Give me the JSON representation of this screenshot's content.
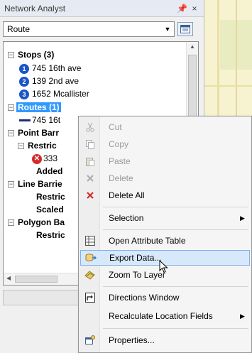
{
  "window": {
    "title": "Network Analyst",
    "pin_glyph": "ͱ",
    "close_glyph": "×"
  },
  "combo": {
    "value": "Route"
  },
  "tree": {
    "stops_header": "Stops (3)",
    "stops": [
      {
        "num": "1",
        "label": "745 16th ave"
      },
      {
        "num": "2",
        "label": "139 2nd ave"
      },
      {
        "num": "3",
        "label": "1652 Mcallister"
      }
    ],
    "routes_header": "Routes (1)",
    "route_item": "745 16t",
    "point_barriers": "Point Barr",
    "restrictions_1": "Restric",
    "barrier_item": "333",
    "added": "Added",
    "line_barriers": "Line Barrie",
    "restrictions_2": "Restric",
    "scaled": "Scaled",
    "polygon_barriers": "Polygon Ba",
    "restrictions_3": "Restric"
  },
  "menu": {
    "items": [
      {
        "label": "Cut",
        "icon": "scissors-icon"
      },
      {
        "label": "Copy",
        "icon": "copy-icon"
      },
      {
        "label": "Paste",
        "icon": "paste-icon"
      },
      {
        "label": "Delete",
        "icon": "delete-icon"
      },
      {
        "label": "Delete All",
        "icon": "delete-all-icon"
      },
      {
        "label": "Selection",
        "icon": ""
      },
      {
        "label": "Open Attribute Table",
        "icon": "table-icon"
      },
      {
        "label": "Export Data...",
        "icon": "export-icon"
      },
      {
        "label": "Zoom To Layer",
        "icon": "zoom-layer-icon"
      },
      {
        "label": "Directions Window",
        "icon": "directions-icon"
      },
      {
        "label": "Recalculate Location Fields",
        "icon": ""
      },
      {
        "label": "Properties...",
        "icon": "properties-icon"
      }
    ]
  },
  "colors": {
    "accent": "#3399ff",
    "badge_blue": "#1a55c7",
    "error_red": "#d42a2a",
    "menu_hover": "#d8e8fb"
  }
}
